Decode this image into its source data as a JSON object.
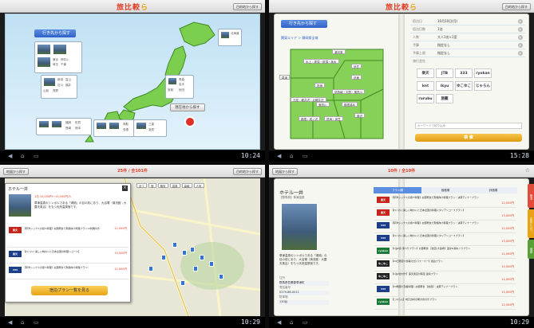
{
  "logo": {
    "main": "旅比較",
    "accent": "ら",
    "tail": "ら"
  },
  "colors": {
    "accent": "#e33a22",
    "header_blue": "#3b6fd2",
    "price_red": "#e13a25",
    "book_green": "#7ccf4e"
  },
  "panel1": {
    "button_top": "目的地から探す",
    "where_header": "行き先から探す",
    "near_button": "現在地から探す",
    "clock": "10:24",
    "map_tags_north": [
      "北海道"
    ],
    "map_tags_tohoku": [
      "青森",
      "岩手",
      "宮城",
      "秋田",
      "山形",
      "福島"
    ],
    "map_tags_kanto": [
      "東京",
      "神奈川",
      "埼玉",
      "千葉",
      "茨城",
      "栃木",
      "群馬"
    ],
    "map_tags_chubu": [
      "新潟",
      "富山",
      "石川",
      "福井",
      "山梨",
      "長野"
    ],
    "map_tags_kinki": [
      "三重",
      "滋賀",
      "京都",
      "大阪",
      "兵庫",
      "奈良"
    ],
    "map_tags_chugoku": [
      "鳥取",
      "島根",
      "岡山",
      "広島",
      "山口"
    ],
    "map_tags_kyushu": [
      "福岡",
      "佐賀",
      "長崎",
      "熊本",
      "大分"
    ]
  },
  "panel2": {
    "button_top": "目的地から探す",
    "where_header": "行き先から探す",
    "breadcrumb": "関東エリア ＞ 静岡県全域",
    "clock": "15:28",
    "regions": [
      "湯河原",
      "水上・那須・那須・栃木",
      "草津",
      "伊豆",
      "熱海",
      "伊東",
      "伊勢崎・天野・鬼怒川",
      "万座・軽井沢・北軽井沢",
      "鬼怒川",
      "箱根湯本",
      "箱根・塔ノ沢",
      "熱海・伊豆",
      "藤沢",
      "湯沢"
    ],
    "form": [
      {
        "label": "宿泊日",
        "value": "10月10日(月)"
      },
      {
        "label": "宿泊日数",
        "value": "1泊"
      },
      {
        "label": "人数",
        "value": "大人1名×1室"
      },
      {
        "label": "予算",
        "value": "指定なし"
      },
      {
        "label": "予算上限",
        "value": "指定なし"
      },
      {
        "label": "旅行会社",
        "value": ""
      }
    ],
    "brands": [
      {
        "name": "楽天",
        "color": "#c7251b"
      },
      {
        "name": "JTB",
        "color": "#1e3f9e"
      },
      {
        "name": "333",
        "color": "#1c3f8c"
      },
      {
        "name": "ryokan",
        "color": "#1a7a3a"
      },
      {
        "name": "knt",
        "color": "#1a4fb3"
      },
      {
        "name": "ikyu",
        "color": "#3a3a3a"
      },
      {
        "name": "ゆこゆこ",
        "color": "#222222"
      },
      {
        "name": "じゃらん",
        "color": "#d02d2d"
      },
      {
        "name": "rurubu",
        "color": "#c22e2e"
      },
      {
        "name": "旅籠",
        "color": "#555555"
      }
    ],
    "keyword_label": "キーワードで絞り込み",
    "search_button": "検 索"
  },
  "panel3": {
    "title_count": "25件 / 全101件",
    "button_top": "目的地から探す",
    "back_button": "地図から探す",
    "hotel_name": "ホテル一井",
    "hotel_price": "1泊 10,000円〜15,000円/人",
    "hotel_desc": "草津温泉のシンボルである「湯畑」の目の前にあり、大浴場（清流館・大露天風呂）をもつ天然温泉宿です。",
    "plans": [
      {
        "vendor": "楽天",
        "text": "【草津シックスの街!!料理】お部屋食で家族向け料理プラン!※特典付き",
        "price": "12,000円"
      },
      {
        "vendor": "楽天",
        "text": "【わくわく楽しい味わいと日本全国の料理〜コース】",
        "price": "13,000円"
      },
      {
        "vendor": "333",
        "text": "【草津シックスの街!!料理】お部屋食で家族向け料理プラン!",
        "price": "12,000円"
      }
    ],
    "see_plans_button": "宿泊プラン一覧を見る",
    "map_labels": [
      "全て",
      "宿",
      "格安",
      "温泉",
      "高級",
      "人気"
    ],
    "clock": "10:29"
  },
  "panel4": {
    "title_count": "10件 / 全10件",
    "back_button": "地図から探す",
    "hotel_name": "ホテル一井",
    "hotel_sub": "【群馬県】草津温泉",
    "hotel_desc": "草津温泉のシンボルである「湯畑」の目の前にあり、大浴場（清流館・大露天風呂）をもつ天然温泉宿です。",
    "info_rows": [
      {
        "label": "住所",
        "value": "群馬県吾妻郡草津町"
      },
      {
        "label": "電話番号",
        "value": "0279-88-0011"
      },
      {
        "label": "駐車場",
        "value": "130台"
      },
      {
        "label": "チェックイン",
        "value": "15:00"
      }
    ],
    "tabs": [
      "プラン順",
      "価格順",
      "評価順"
    ],
    "plans": [
      {
        "vendor": "楽天",
        "text": "【草津シックスの街!!料理】お部屋食で家族向け料理プラン・決算ディナープラン",
        "price": "12,000円"
      },
      {
        "vendor": "楽天",
        "text": "【わくわく楽しい味わいと日本全国の料理イタリアンコースプラン】",
        "price": "13,000円"
      },
      {
        "vendor": "333",
        "text": "【草津シックスの街!!料理】お部屋食で家族向け料理プラン・決算ディナープラン",
        "price": "12,000円"
      },
      {
        "vendor": "333",
        "text": "【わくわく楽しい味わいと日本全国の料理イタリアンコースプラン】",
        "price": "13,000円"
      },
      {
        "vendor": "ryokan",
        "text": "【1泊2食 湯つりプラン】お部屋食 【吉田-大浴場】温泉&湯めぐりプラン",
        "price": "11,000円"
      },
      {
        "vendor": "ゆこゆこ",
        "text": "【24日限定!!食事付き】【スーパー】宿泊プラン",
        "price": "10,500円"
      },
      {
        "vendor": "ゆこゆこ",
        "text": "【1泊2食付き】露天風呂付客室 温泉プラン",
        "price": "14,000円"
      },
      {
        "vendor": "333",
        "text": "【24時間!!高級料理】お部屋食 【吉田】・決算ディナープラン",
        "price": "15,000円"
      },
      {
        "vendor": "ryokan",
        "text": "【じゃらん】地元食材の朝夕食付きプラン",
        "price": "12,500円"
      }
    ],
    "side_tabs": [
      "宿泊",
      "お気に入り",
      "地図"
    ],
    "clock": "10:29"
  }
}
